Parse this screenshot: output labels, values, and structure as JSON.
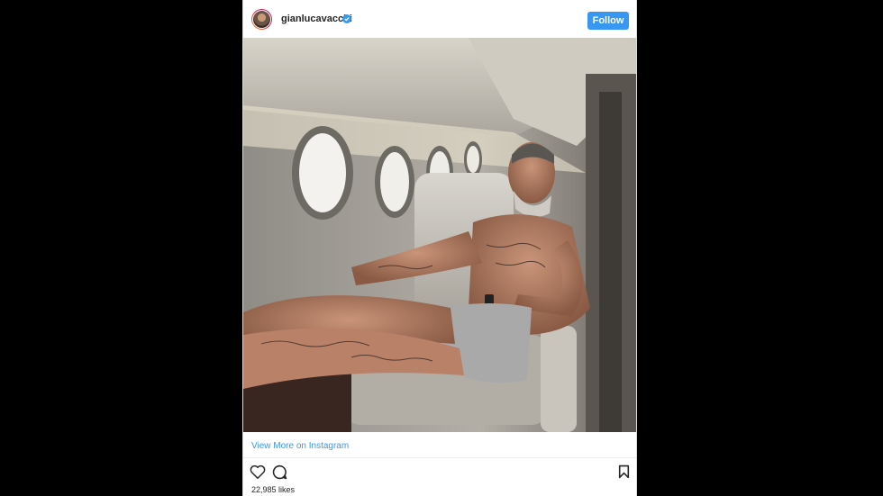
{
  "post": {
    "username": "gianlucavacchi",
    "follow_label": "Follow",
    "view_more": "View More on Instagram",
    "likes": "22,985 likes"
  },
  "icons": {
    "verified": "verified-badge-icon",
    "like": "heart-icon",
    "comment": "comment-icon",
    "save": "bookmark-icon"
  },
  "colors": {
    "accent": "#3897f0",
    "text": "#262626",
    "background": "#000000"
  }
}
